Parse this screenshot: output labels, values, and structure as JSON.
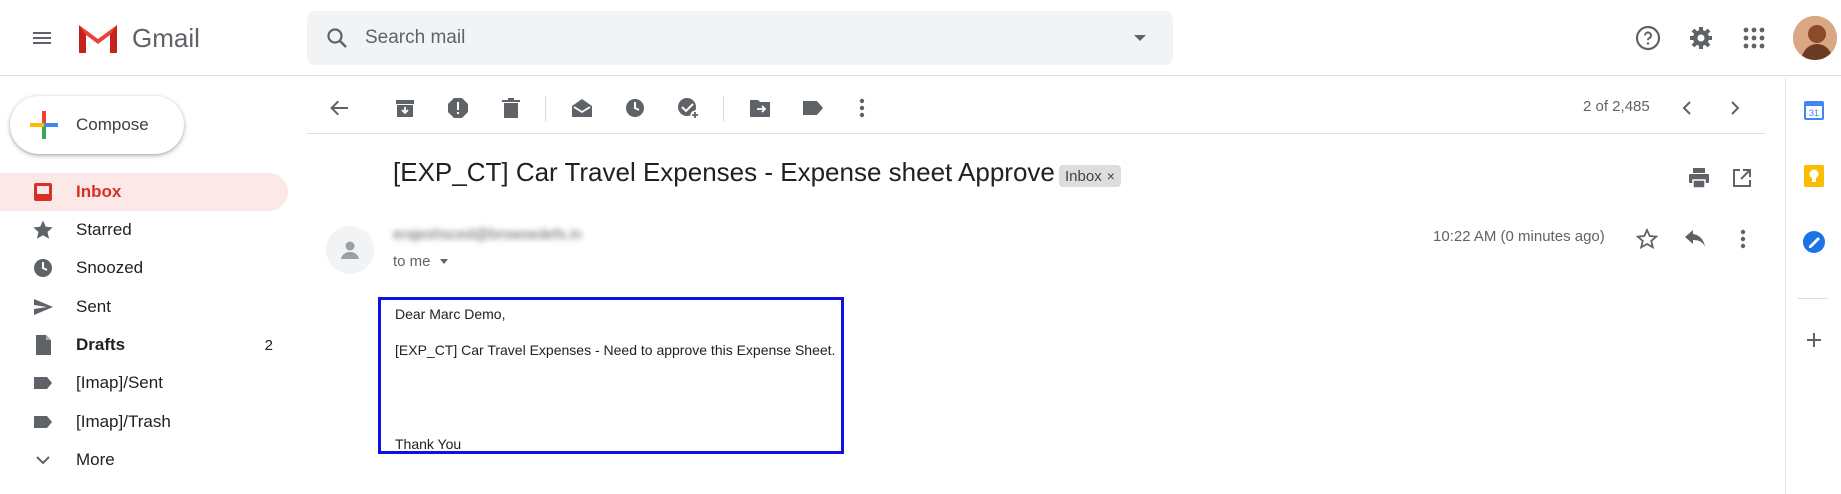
{
  "header": {
    "app_name": "Gmail",
    "search_placeholder": "Search mail"
  },
  "sidebar": {
    "compose_label": "Compose",
    "items": [
      {
        "label": "Inbox",
        "count": "",
        "active": true
      },
      {
        "label": "Starred",
        "count": ""
      },
      {
        "label": "Snoozed",
        "count": ""
      },
      {
        "label": "Sent",
        "count": ""
      },
      {
        "label": "Drafts",
        "count": "2",
        "bold": true
      },
      {
        "label": "[Imap]/Sent",
        "count": ""
      },
      {
        "label": "[Imap]/Trash",
        "count": ""
      },
      {
        "label": "More",
        "count": ""
      }
    ]
  },
  "toolbar": {
    "pager": "2 of 2,485"
  },
  "email": {
    "subject": "[EXP_CT] Car Travel Expenses - Expense sheet Approve",
    "label": "Inbox",
    "label_close": "×",
    "sender": "erajeshsced@browsedefs.in",
    "to": "to me",
    "timestamp": "10:22 AM (0 minutes ago)",
    "body": {
      "greeting": "Dear Marc Demo,",
      "line1": "[EXP_CT] Car Travel Expenses - Need to approve this Expense Sheet.",
      "closing": "Thank You"
    }
  },
  "side_panel": {
    "calendar_day": "31"
  },
  "colors": {
    "accent_red": "#d93025",
    "active_bg": "#fce8e6",
    "highlight_box": "#1010e0"
  }
}
